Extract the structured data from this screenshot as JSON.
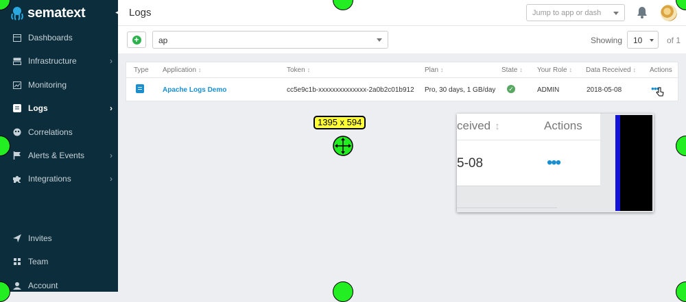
{
  "sidebar": {
    "brand": "sematext",
    "items": [
      {
        "label": "Dashboards",
        "icon": "dashboard-icon",
        "chevron": false
      },
      {
        "label": "Infrastructure",
        "icon": "server-icon",
        "chevron": true
      },
      {
        "label": "Monitoring",
        "icon": "chart-icon",
        "chevron": false
      },
      {
        "label": "Logs",
        "icon": "logs-icon",
        "chevron": true,
        "active": true
      },
      {
        "label": "Correlations",
        "icon": "correlations-icon",
        "chevron": false
      },
      {
        "label": "Alerts & Events",
        "icon": "flag-icon",
        "chevron": true
      },
      {
        "label": "Integrations",
        "icon": "puzzle-icon",
        "chevron": true
      },
      {
        "label": "Invites",
        "icon": "send-icon",
        "chevron": false
      },
      {
        "label": "Team",
        "icon": "team-icon",
        "chevron": false
      },
      {
        "label": "Account",
        "icon": "user-icon",
        "chevron": false
      }
    ]
  },
  "header": {
    "title": "Logs",
    "jump_placeholder": "Jump to app or dash"
  },
  "filter": {
    "app_value": "ap",
    "showing_label": "Showing",
    "page_size": "10",
    "of_pages": "of 1"
  },
  "table": {
    "columns": [
      "Type",
      "Application",
      "Token",
      "Plan",
      "State",
      "Your Role",
      "Data Received",
      "Actions"
    ],
    "rows": [
      {
        "application": "Apache Logs Demo",
        "token": "cc5e9c1b-xxxxxxxxxxxxxx-2a0b2c01b912",
        "plan": "Pro, 30 days, 1 GB/day",
        "state": "ok",
        "role": "ADMIN",
        "data_received": "2018-05-08",
        "actions": "•••"
      }
    ]
  },
  "overlay": {
    "dimensions": "1395 x 594",
    "zoom_header_1": "ceived",
    "zoom_header_2": "Actions",
    "zoom_value": "5-08",
    "zoom_dots": "•••"
  },
  "colors": {
    "sidebar_bg": "#0c2d3b",
    "accent": "#1a8fd0",
    "success": "#58a863",
    "handle": "#22ee22"
  }
}
